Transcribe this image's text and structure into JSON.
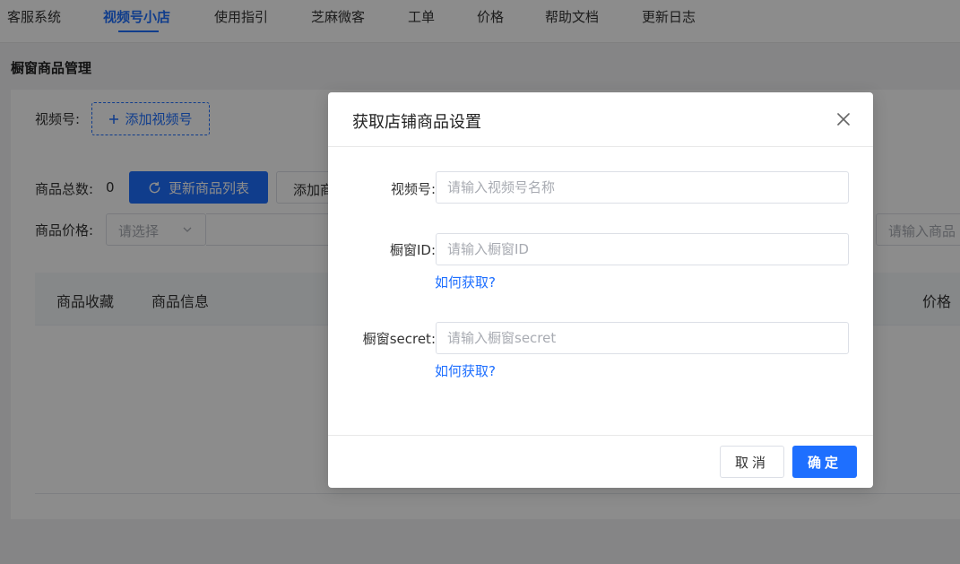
{
  "nav": {
    "items": [
      "客服系统",
      "视频号小店",
      "使用指引",
      "芝麻微客",
      "工单",
      "价格",
      "帮助文档",
      "更新日志"
    ],
    "active": "视频号小店"
  },
  "page": {
    "title": "橱窗商品管理"
  },
  "main": {
    "channel_label": "视频号:",
    "add_channel_button": "添加视频号",
    "total_label": "商品总数:",
    "total_value": "0",
    "refresh_button": "更新商品列表",
    "add_button_partial": "添加商",
    "price_label": "商品价格:",
    "price_select_placeholder": "请选择",
    "search_placeholder_partial": "请输入商品",
    "table_headers": [
      "商品收藏",
      "商品信息",
      "价格"
    ]
  },
  "dialog": {
    "title": "获取店铺商品设置",
    "fields": [
      {
        "label": "视频号:",
        "placeholder": "请输入视频号名称"
      },
      {
        "label": "橱窗ID:",
        "placeholder": "请输入橱窗ID",
        "help": "如何获取?"
      },
      {
        "label": "橱窗secret:",
        "placeholder": "请输入橱窗secret",
        "help": "如何获取?"
      }
    ],
    "cancel_button": "取消",
    "confirm_button": "确定"
  },
  "colors": {
    "primary": "#1e6fff",
    "overlay": "rgba(0,0,0,0.45)"
  }
}
